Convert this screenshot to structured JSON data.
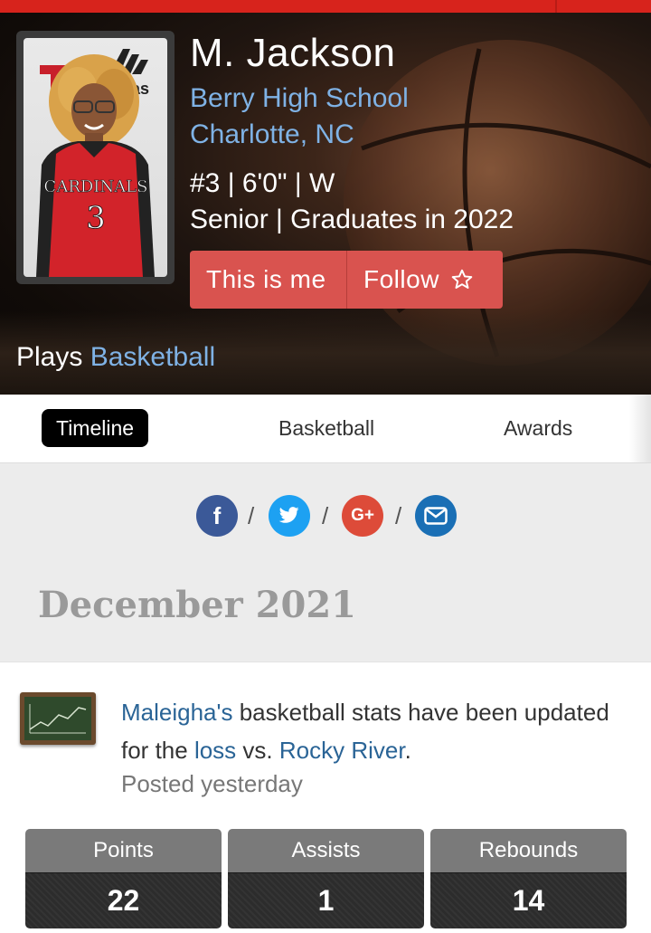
{
  "profile": {
    "name": "M. Jackson",
    "school": "Berry High School",
    "location": "Charlotte, NC",
    "info": "#3 | 6'0\" | W",
    "class": "Senior | Graduates in 2022",
    "jersey_text": "CARDINALS",
    "jersey_number": "3",
    "brand_text": "das"
  },
  "actions": {
    "this_is_me": "This is me",
    "follow": "Follow"
  },
  "plays": {
    "prefix": "Plays",
    "sport": "Basketball"
  },
  "tabs": [
    {
      "label": "Timeline"
    },
    {
      "label": "Basketball"
    },
    {
      "label": "Awards"
    }
  ],
  "share": {
    "facebook": "f",
    "googleplus": "G+",
    "separator": "/"
  },
  "timeline": {
    "month": "December 2021",
    "post": {
      "name_link": "Maleigha's",
      "text1": " basketball stats have been updated for the ",
      "result_link": "loss",
      "text2": " vs. ",
      "opponent_link": "Rocky River",
      "text3": ".",
      "posted": "Posted yesterday"
    },
    "stats": [
      {
        "label": "Points",
        "value": "22"
      },
      {
        "label": "Assists",
        "value": "1"
      },
      {
        "label": "Rebounds",
        "value": "14"
      }
    ]
  },
  "colors": {
    "accent_red": "#d7231c",
    "button_red": "#d9534f",
    "link_blue": "#7fb2e5",
    "facebook": "#3b5998",
    "twitter": "#1da1f2",
    "googleplus": "#dd4b39",
    "email": "#1a6fb5"
  },
  "icons": [
    "star-outline-icon",
    "facebook-icon",
    "twitter-icon",
    "google-plus-icon",
    "email-icon",
    "chalkboard-chart-icon"
  ]
}
